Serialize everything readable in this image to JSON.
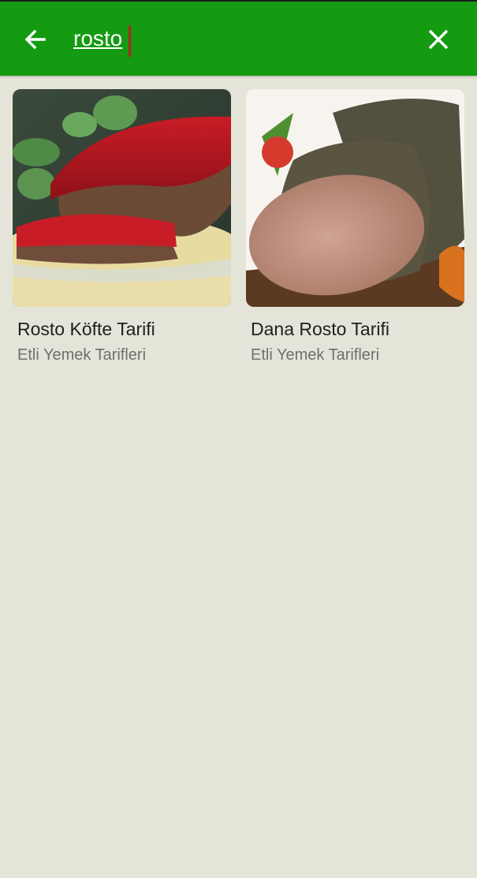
{
  "search": {
    "value": "rosto",
    "placeholder": ""
  },
  "icons": {
    "back": "arrow-left-icon",
    "clear": "close-icon"
  },
  "colors": {
    "appbar": "#149b12",
    "background": "#e4e4d9",
    "caret": "#b3261e"
  },
  "results": [
    {
      "title": "Rosto Köfte Tarifi",
      "category": "Etli Yemek Tarifleri",
      "image": "meatloaf-with-red-sauce"
    },
    {
      "title": "Dana Rosto Tarifi",
      "category": "Etli Yemek Tarifleri",
      "image": "herb-crusted-roast-beef-slices"
    }
  ]
}
